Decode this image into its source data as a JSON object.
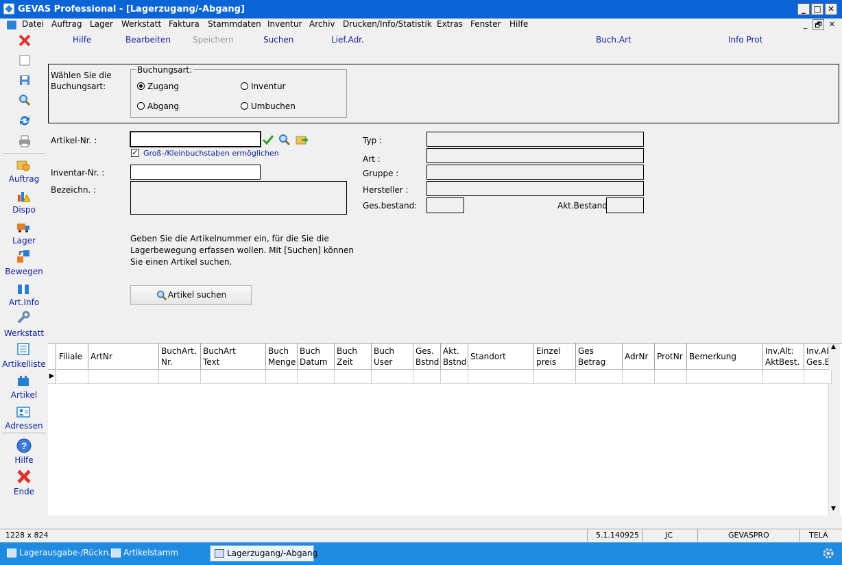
{
  "window": {
    "title": "GEVAS Professional - [Lagerzugang/-Abgang]",
    "controls": [
      "_",
      "□",
      "✕"
    ],
    "mdi_controls": [
      "_",
      "🗗",
      "✕"
    ]
  },
  "menu": [
    "Datei",
    "Auftrag",
    "Lager",
    "Werkstatt",
    "Faktura",
    "Stammdaten",
    "Inventur",
    "Archiv",
    "Drucken/Info/Statistik",
    "Extras",
    "Fenster",
    "Hilfe"
  ],
  "toolbar": {
    "hilfe": "Hilfe",
    "bearbeiten": "Bearbeiten",
    "speichern": "Speichern",
    "suchen": "Suchen",
    "lief_adr": "Lief.Adr.",
    "buch_art": "Buch.Art",
    "info_prot": "Info Prot"
  },
  "sidebar": {
    "items": [
      "Auftrag",
      "Dispo",
      "Lager",
      "Bewegen",
      "Art.Info",
      "Werkstatt",
      "Artikelliste",
      "Artikel",
      "Adressen"
    ],
    "help": "Hilfe",
    "end": "Ende",
    "colors": {
      "close": "#e03131",
      "label": "#0a1fa0"
    }
  },
  "form": {
    "prompt": "Wählen Sie die Buchungsart:",
    "group_title": "Buchungsart:",
    "radios": {
      "zugang": "Zugang",
      "abgang": "Abgang",
      "inventur": "Inventur",
      "umbuchen": "Umbuchen"
    },
    "selected": "Zugang",
    "artikel_nr_label": "Artikel-Nr. :",
    "artikel_nr_value": "",
    "case_checkbox_label": "Groß-/Kleinbuchstaben ermöglichen",
    "case_checkbox_checked": true,
    "inventar_nr_label": "Inventar-Nr. :",
    "bezeichn_label": "Bezeichn. :",
    "typ_label": "Typ :",
    "art_label": "Art :",
    "gruppe_label": "Gruppe :",
    "hersteller_label": "Hersteller :",
    "ges_bestand_label": "Ges.bestand:",
    "akt_bestand_label": "Akt.Bestand:",
    "hint": "Geben Sie die Artikelnummer ein, für die Sie die Lagerbewegung erfassen wollen. Mit [Suchen] können Sie einen Artikel suchen.",
    "search_button": "Artikel suchen"
  },
  "grid": {
    "columns": [
      {
        "line1": "Filiale",
        "line2": ""
      },
      {
        "line1": "ArtNr",
        "line2": ""
      },
      {
        "line1": "BuchArt.",
        "line2": "Nr."
      },
      {
        "line1": "BuchArt",
        "line2": "Text"
      },
      {
        "line1": "Buch",
        "line2": "Menge"
      },
      {
        "line1": "Buch",
        "line2": "Datum"
      },
      {
        "line1": "Buch",
        "line2": "Zeit"
      },
      {
        "line1": "Buch",
        "line2": "User"
      },
      {
        "line1": "Ges.",
        "line2": "Bstnd"
      },
      {
        "line1": "Akt.",
        "line2": "Bstnd"
      },
      {
        "line1": "Standort",
        "line2": ""
      },
      {
        "line1": "Einzel",
        "line2": "preis"
      },
      {
        "line1": "Ges",
        "line2": "Betrag"
      },
      {
        "line1": "AdrNr",
        "line2": ""
      },
      {
        "line1": "ProtNr",
        "line2": ""
      },
      {
        "line1": "Bemerkung",
        "line2": ""
      },
      {
        "line1": "Inv.Alt:",
        "line2": "AktBest."
      },
      {
        "line1": "Inv.Alt:",
        "line2": "Ges.Best."
      }
    ]
  },
  "status": {
    "resolution": "1228 x 824",
    "version": "5.1.140925",
    "user": "JC",
    "db": "GEVASPRO",
    "station": "TELA"
  },
  "taskbar": {
    "tasks": [
      "Lagerausgabe-/Rückn...",
      "Artikelstamm",
      "Lagerzugang/-Abgang"
    ],
    "active_index": 2
  }
}
